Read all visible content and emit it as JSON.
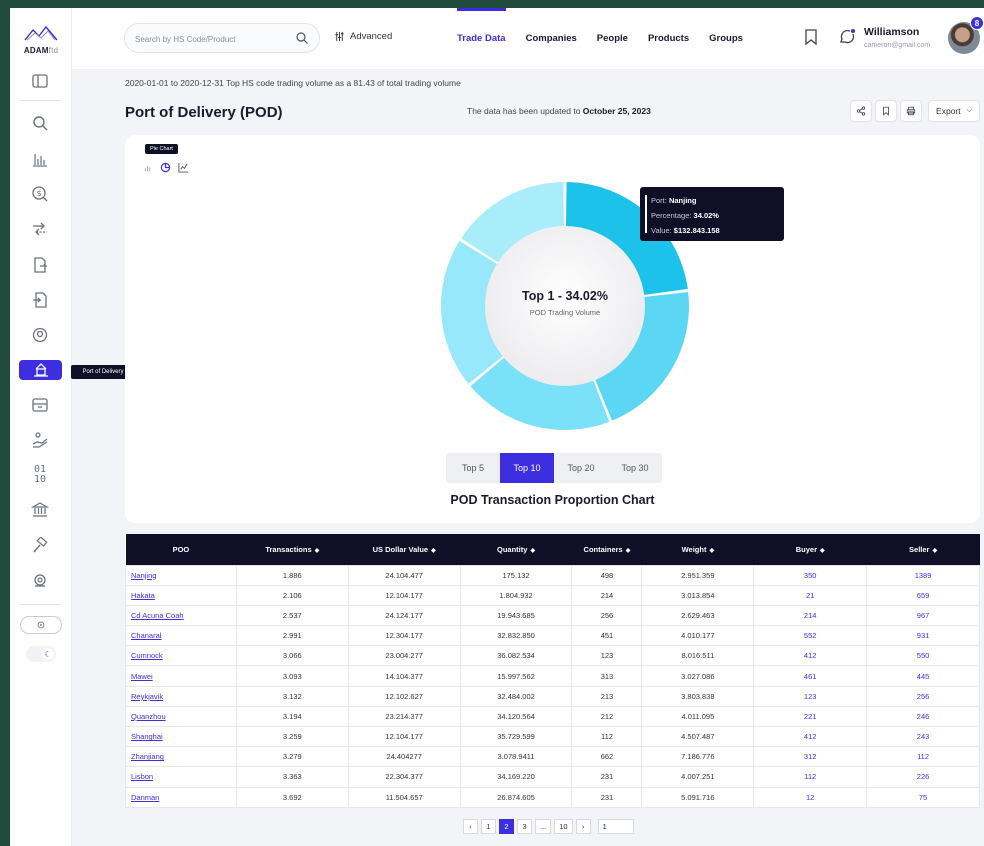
{
  "brand": {
    "name": "ADAM",
    "suffix": "ftd"
  },
  "sidebar": {
    "items": [
      {
        "icon": "panel-icon"
      },
      {
        "icon": "search-icon"
      },
      {
        "icon": "bar-chart-icon"
      },
      {
        "icon": "dollar-search-icon"
      },
      {
        "icon": "exchange-icon"
      },
      {
        "icon": "export-doc-icon"
      },
      {
        "icon": "import-doc-icon"
      },
      {
        "icon": "location-pin-icon"
      },
      {
        "icon": "port-delivery-icon",
        "active": true,
        "tooltip": "Port of Delivery"
      },
      {
        "icon": "box-icon"
      },
      {
        "icon": "hand-coin-icon"
      },
      {
        "icon": "binary-icon"
      },
      {
        "icon": "bank-icon"
      },
      {
        "icon": "hammer-icon"
      },
      {
        "icon": "target-pin-icon"
      }
    ]
  },
  "topbar": {
    "search_placeholder": "Search by HS Code/Product",
    "advanced_label": "Advanced",
    "nav": [
      "Trade Data",
      "Companies",
      "People",
      "Products",
      "Groups"
    ],
    "active_nav": "Trade Data",
    "user_name": "Williamson",
    "user_email": "cameron@gmail.com",
    "notification_count": "8"
  },
  "header": {
    "subtitle": "2020-01-01 to 2020-12-31 Top HS code trading volume as a 81.43 of total trading volume",
    "title": "Port of Delivery (POD)",
    "update_prefix": "The data has been updated to ",
    "update_date": "October 25, 2023",
    "export_label": "Export"
  },
  "chart": {
    "type_tooltip": "Pie Chart",
    "center_title": "Top 1 - 34.02%",
    "center_sub": "POD Trading Volume",
    "tooltip": {
      "port_label": "Port: ",
      "port": "Nanjing",
      "pct_label": "Percentage: ",
      "pct": "34.02%",
      "value_label": "Value: ",
      "value": "$132.843.158"
    },
    "tabs": [
      "Top 5",
      "Top 10",
      "Top 20",
      "Top 30"
    ],
    "active_tab": "Top 10",
    "caption": "POD Transaction Proportion Chart"
  },
  "chart_data": {
    "type": "pie",
    "categories": [
      "Nanjing",
      "",
      "",
      "",
      ""
    ],
    "values": [
      23,
      21,
      20,
      20,
      16
    ],
    "colors": [
      "#1cc2ea",
      "#5bd7f4",
      "#7be1f8",
      "#97e8fa",
      "#a9edfb"
    ],
    "note_values_estimated": true
  },
  "table": {
    "columns": [
      "POO",
      "Transactions",
      "US Dollar Value",
      "Quantity",
      "Containers",
      "Weight",
      "Buyer",
      "Seller"
    ],
    "rows": [
      [
        "Nanjing",
        "1.886",
        "24.104.477",
        "175.132",
        "498",
        "2.951.359",
        "350",
        "1389"
      ],
      [
        "Hakata",
        "2.106",
        "12.104.177",
        "1.804.932",
        "214",
        "3.013.854",
        "21",
        "659"
      ],
      [
        "Cd Acuna Coah",
        "2.537",
        "24.124.177",
        "19.943.685",
        "256",
        "2.629.463",
        "214",
        "967"
      ],
      [
        "Chanaral",
        "2.991",
        "12.304.177",
        "32.832.850",
        "451",
        "4.010.177",
        "552",
        "931"
      ],
      [
        "Cumnock",
        "3.066",
        "23.004.277",
        "36.082.534",
        "123",
        "8.016.511",
        "412",
        "550"
      ],
      [
        "Mawei",
        "3.093",
        "14.104.377",
        "15.997.562",
        "313",
        "3.027.086",
        "461",
        "445"
      ],
      [
        "Reykjavik",
        "3.132",
        "12.102.627",
        "32.484.002",
        "213",
        "3.803.838",
        "123",
        "256"
      ],
      [
        "Quanzhou",
        "3.194",
        "23.214.377",
        "34.120.564",
        "212",
        "4.011.095",
        "221",
        "246"
      ],
      [
        "Shanghai",
        "3.259",
        "12.104.177",
        "35.729.599",
        "112",
        "4.507.487",
        "412",
        "243"
      ],
      [
        "Zhanjiang",
        "3.279",
        "24.404277",
        "3.078.9411",
        "662",
        "7.186.776",
        "312",
        "112"
      ],
      [
        "Lisbon",
        "3.363",
        "22.304.377",
        "34.169.220",
        "231",
        "4.007.251",
        "112",
        "226"
      ],
      [
        "Danman",
        "3.692",
        "11.504.657",
        "26.874.605",
        "231",
        "5.091.716",
        "12",
        "75"
      ]
    ]
  },
  "pagination": {
    "pages": [
      "1",
      "2",
      "3",
      "...",
      "10"
    ],
    "active": "2",
    "goto_value": "1"
  }
}
